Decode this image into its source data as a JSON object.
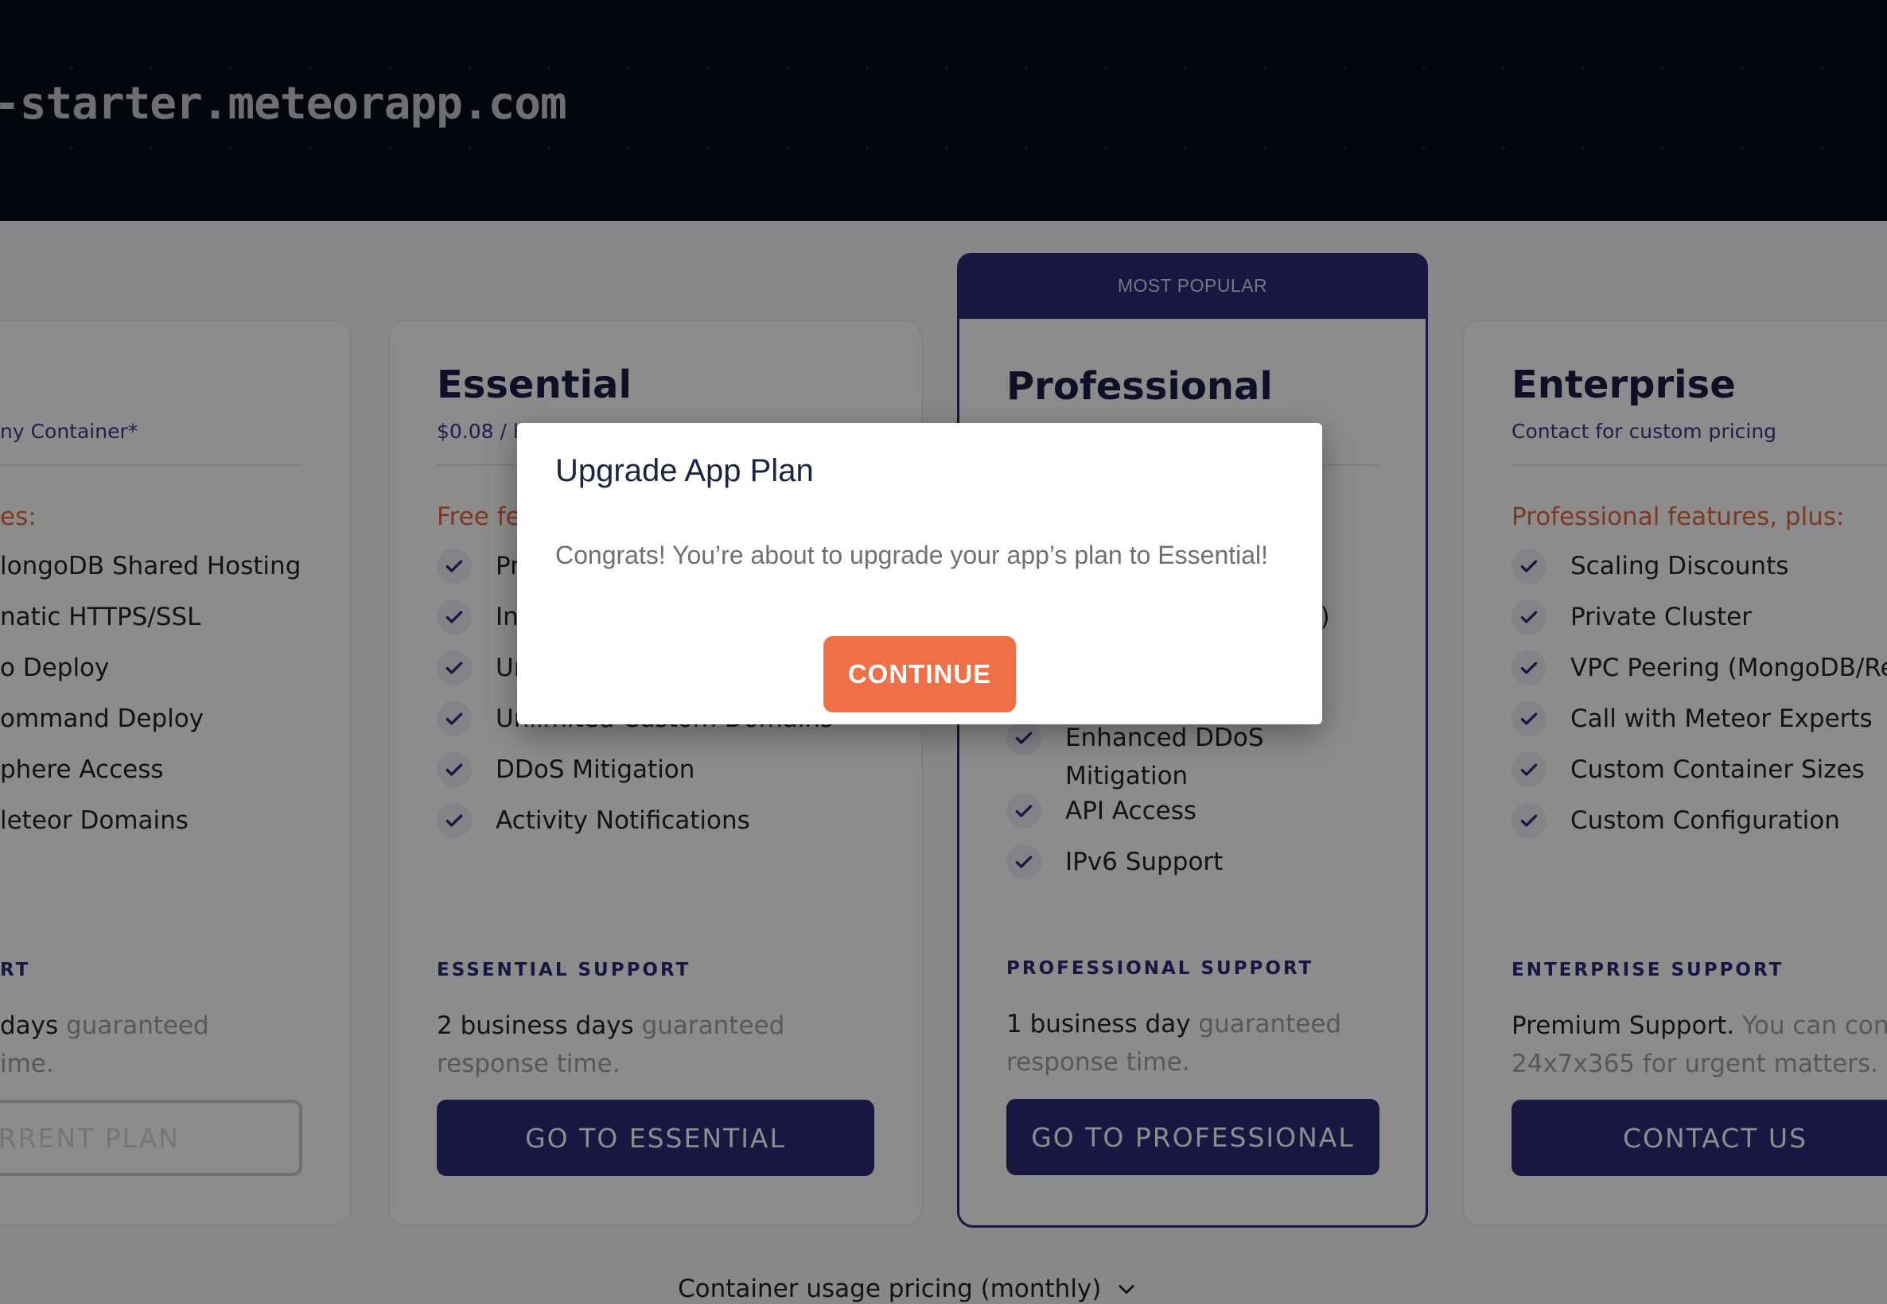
{
  "header": {
    "domain": "-starter.meteorapp.com"
  },
  "plans": {
    "free": {
      "price": "ny Container*",
      "features_head": "es:",
      "features": [
        "longoDB Shared Hosting",
        "natic HTTPS/SSL",
        "o Deploy",
        "ommand Deploy",
        "phere Access",
        "leteor Domains"
      ],
      "support_head": "RT",
      "support_strong": "days",
      "support_rest": " guaranteed",
      "support_line2": "ime.",
      "button": "CURRENT PLAN"
    },
    "essential": {
      "title": "Essential",
      "price": "$0.08 / h",
      "features_head": "Free fe",
      "features": [
        "Pr",
        "In",
        "Ur",
        "Unlimited Custom Domains",
        "DDoS Mitigation",
        "Activity Notifications"
      ],
      "support_head": "ESSENTIAL SUPPORT",
      "support_strong": "2 business days",
      "support_rest": " guaranteed response time.",
      "button": "GO TO ESSENTIAL"
    },
    "professional": {
      "badge": "MOST POPULAR",
      "title": "Professional",
      "features": [
        "g)",
        "Enhanced DDoS Mitigation",
        "API Access",
        "IPv6 Support"
      ],
      "support_head": "PROFESSIONAL SUPPORT",
      "support_strong": "1 business day",
      "support_rest": " guaranteed response time.",
      "button": "GO TO PROFESSIONAL"
    },
    "enterprise": {
      "title": "Enterprise",
      "price": "Contact for custom pricing",
      "features_head": "Professional features, plus:",
      "features": [
        "Scaling Discounts",
        "Private Cluster",
        "VPC Peering (MongoDB/Re",
        "Call with Meteor Experts",
        "Custom Container Sizes",
        "Custom Configuration"
      ],
      "support_head": "ENTERPRISE SUPPORT",
      "support_strong": "Premium Support.",
      "support_rest": " You can con",
      "support_line2": "24x7x365 for urgent matters.",
      "button": "CONTACT US"
    }
  },
  "usage_toggle": "Container usage pricing (monthly)",
  "modal": {
    "title": "Upgrade App Plan",
    "body": "Congrats! You’re about to upgrade your app’s plan to Essential!",
    "button": "CONTINUE"
  },
  "colors": {
    "brand": "#2b2a78",
    "accent": "#ef7047",
    "header_bg": "#070b16"
  }
}
